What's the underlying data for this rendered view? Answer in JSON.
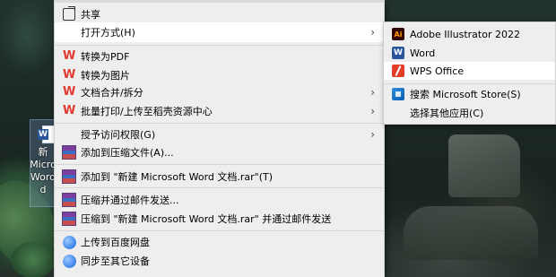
{
  "desktop": {
    "icon_label": "新 Micro Word d"
  },
  "context_menu": {
    "items": [
      {
        "label": "共享",
        "icon": "share-icon"
      },
      {
        "label": "打开方式(H)",
        "icon": "none",
        "submenu": true,
        "highlighted": true
      },
      {
        "label": "转换为PDF",
        "icon": "wps-icon"
      },
      {
        "label": "转换为图片",
        "icon": "wps-icon"
      },
      {
        "label": "文档合并/拆分",
        "icon": "wps-icon",
        "submenu": true
      },
      {
        "label": "批量打印/上传至稻壳资源中心",
        "icon": "wps-icon",
        "submenu": true
      },
      {
        "label": "授予访问权限(G)",
        "icon": "none",
        "submenu": true
      },
      {
        "label": "添加到压缩文件(A)...",
        "icon": "winrar-icon"
      },
      {
        "label": "添加到 \"新建 Microsoft Word 文档.rar\"(T)",
        "icon": "winrar-icon"
      },
      {
        "label": "压缩并通过邮件发送...",
        "icon": "winrar-icon"
      },
      {
        "label": "压缩到 \"新建 Microsoft Word 文档.rar\" 并通过邮件发送",
        "icon": "winrar-icon"
      },
      {
        "label": "上传到百度网盘",
        "icon": "baidu-netdisk-icon"
      },
      {
        "label": "同步至其它设备",
        "icon": "baidu-netdisk-icon"
      }
    ]
  },
  "open_with_submenu": {
    "items": [
      {
        "label": "Adobe Illustrator 2022",
        "icon": "illustrator-icon"
      },
      {
        "label": "Word",
        "icon": "word-icon"
      },
      {
        "label": "WPS Office",
        "icon": "wps-office-icon",
        "highlighted": true
      },
      {
        "label": "搜索 Microsoft Store(S)",
        "icon": "microsoft-store-icon"
      },
      {
        "label": "选择其他应用(C)",
        "icon": "none"
      }
    ]
  },
  "glyphs": {
    "arrow": "›",
    "ai": "Ai",
    "w": "W"
  }
}
